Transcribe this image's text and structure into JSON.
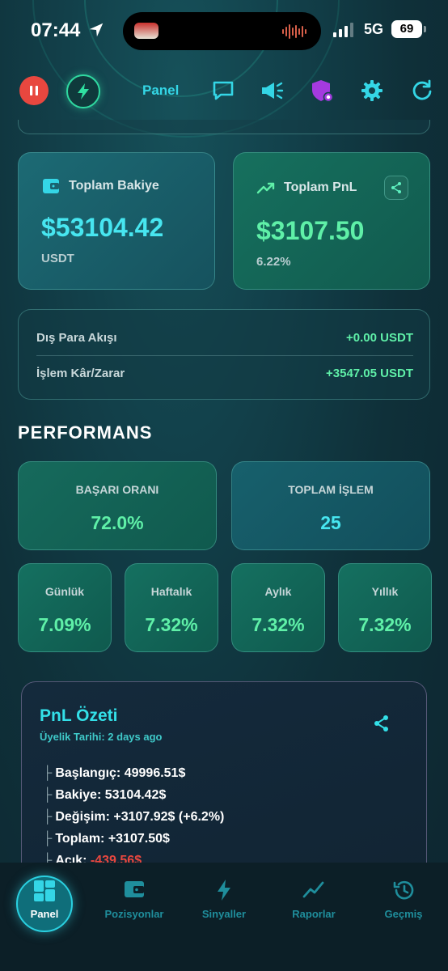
{
  "status_bar": {
    "time": "07:44",
    "network": "5G",
    "battery": "69"
  },
  "top_bar": {
    "panel_label": "Panel",
    "icons": [
      "pause-icon",
      "bolt-icon",
      "chat-icon",
      "megaphone-icon",
      "shield-icon",
      "gear-icon",
      "refresh-icon"
    ]
  },
  "balance_card": {
    "label": "Toplam Bakiye",
    "value": "$53104.42",
    "unit": "USDT"
  },
  "pnl_card": {
    "label": "Toplam PnL",
    "value": "$3107.50",
    "percent": "6.22%"
  },
  "flow": {
    "rows": [
      {
        "label": "Dış Para Akışı",
        "value": "+0.00 USDT"
      },
      {
        "label": "İşlem Kâr/Zarar",
        "value": "+3547.05 USDT"
      }
    ]
  },
  "performance": {
    "title": "PERFORMANS",
    "success_rate": {
      "label": "BAŞARI ORANI",
      "value": "72.0%"
    },
    "total_trades": {
      "label": "TOPLAM İŞLEM",
      "value": "25"
    },
    "periods": [
      {
        "label": "Günlük",
        "value": "7.09%"
      },
      {
        "label": "Haftalık",
        "value": "7.32%"
      },
      {
        "label": "Aylık",
        "value": "7.32%"
      },
      {
        "label": "Yıllık",
        "value": "7.32%"
      }
    ]
  },
  "pnl_summary": {
    "title": "PnL Özeti",
    "membership": "Üyelik Tarihi: 2 days ago",
    "tree": "├",
    "lines": [
      {
        "label": "Başlangıç:",
        "value": "49996.51$"
      },
      {
        "label": "Bakiye:",
        "value": "53104.42$"
      },
      {
        "label": "Değişim:",
        "value": "+3107.92$ (+6.2%)"
      },
      {
        "label": "Toplam:",
        "value": "+3107.50$"
      },
      {
        "label": "Açık:",
        "value": "-439.56$"
      }
    ]
  },
  "bottom_nav": {
    "items": [
      {
        "label": "Panel",
        "active": true
      },
      {
        "label": "Pozisyonlar",
        "active": false
      },
      {
        "label": "Sinyaller",
        "active": false
      },
      {
        "label": "Raporlar",
        "active": false
      },
      {
        "label": "Geçmiş",
        "active": false
      }
    ]
  },
  "colors": {
    "accent_cyan": "#34d6e6",
    "positive_green": "#5ff0a8",
    "negative_red": "#e8473f"
  }
}
